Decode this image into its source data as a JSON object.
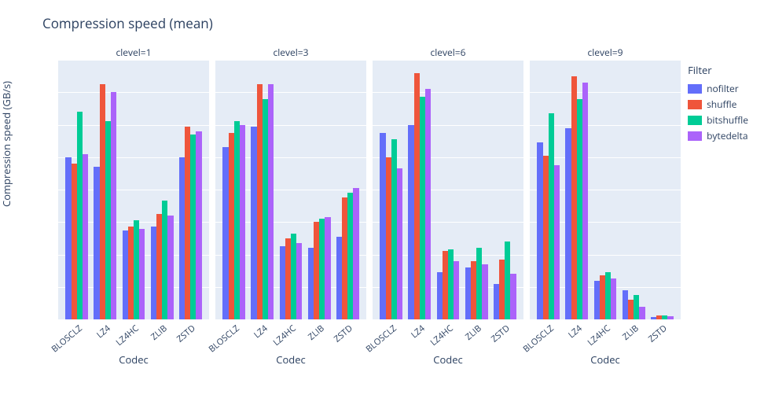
{
  "title": "Compression speed (mean)",
  "ylabel": "Compression speed (GB/s)",
  "xlabel": "Codec",
  "legend_title": "Filter",
  "filters": [
    "nofilter",
    "shuffle",
    "bitshuffle",
    "bytedelta"
  ],
  "colors": {
    "nofilter": "#636efa",
    "shuffle": "#ef553b",
    "bitshuffle": "#00cc96",
    "bytedelta": "#ab63fa"
  },
  "categories": [
    "BLOSCLZ",
    "LZ4",
    "LZ4HC",
    "ZLIB",
    "ZSTD"
  ],
  "yticks": [
    0,
    2,
    4,
    6,
    8,
    10,
    12,
    14,
    16
  ],
  "ylim": [
    0,
    16
  ],
  "facets": [
    {
      "title": "clevel=1"
    },
    {
      "title": "clevel=3"
    },
    {
      "title": "clevel=6"
    },
    {
      "title": "clevel=9"
    }
  ],
  "chart_data": [
    {
      "type": "bar",
      "title": "clevel=1",
      "xlabel": "Codec",
      "ylabel": "Compression speed (GB/s)",
      "ylim": [
        0,
        16
      ],
      "categories": [
        "BLOSCLZ",
        "LZ4",
        "LZ4HC",
        "ZLIB",
        "ZSTD"
      ],
      "series": [
        {
          "name": "nofilter",
          "values": [
            10.0,
            9.4,
            5.5,
            5.7,
            10.0
          ]
        },
        {
          "name": "shuffle",
          "values": [
            9.6,
            14.5,
            5.7,
            6.5,
            11.9
          ]
        },
        {
          "name": "bitshuffle",
          "values": [
            12.8,
            12.2,
            6.1,
            7.3,
            11.4
          ]
        },
        {
          "name": "bytedelta",
          "values": [
            10.2,
            14.0,
            5.6,
            6.4,
            11.6
          ]
        }
      ]
    },
    {
      "type": "bar",
      "title": "clevel=3",
      "xlabel": "Codec",
      "ylabel": "Compression speed (GB/s)",
      "ylim": [
        0,
        16
      ],
      "categories": [
        "BLOSCLZ",
        "LZ4",
        "LZ4HC",
        "ZLIB",
        "ZSTD"
      ],
      "series": [
        {
          "name": "nofilter",
          "values": [
            10.6,
            11.9,
            4.5,
            4.4,
            5.1
          ]
        },
        {
          "name": "shuffle",
          "values": [
            11.5,
            14.5,
            5.0,
            6.0,
            7.5
          ]
        },
        {
          "name": "bitshuffle",
          "values": [
            12.2,
            13.6,
            5.3,
            6.2,
            7.8
          ]
        },
        {
          "name": "bytedelta",
          "values": [
            12.0,
            14.5,
            4.7,
            6.3,
            8.1
          ]
        }
      ]
    },
    {
      "type": "bar",
      "title": "clevel=6",
      "xlabel": "Codec",
      "ylabel": "Compression speed (GB/s)",
      "ylim": [
        0,
        16
      ],
      "categories": [
        "BLOSCLZ",
        "LZ4",
        "LZ4HC",
        "ZLIB",
        "ZSTD"
      ],
      "series": [
        {
          "name": "nofilter",
          "values": [
            11.5,
            12.0,
            2.9,
            3.2,
            2.2
          ]
        },
        {
          "name": "shuffle",
          "values": [
            10.0,
            15.2,
            4.2,
            3.6,
            3.7
          ]
        },
        {
          "name": "bitshuffle",
          "values": [
            11.1,
            13.7,
            4.3,
            4.4,
            4.8
          ]
        },
        {
          "name": "bytedelta",
          "values": [
            9.3,
            14.2,
            3.6,
            3.4,
            2.8
          ]
        }
      ]
    },
    {
      "type": "bar",
      "title": "clevel=9",
      "xlabel": "Codec",
      "ylabel": "Compression speed (GB/s)",
      "ylim": [
        0,
        16
      ],
      "categories": [
        "BLOSCLZ",
        "LZ4",
        "LZ4HC",
        "ZLIB",
        "ZSTD"
      ],
      "series": [
        {
          "name": "nofilter",
          "values": [
            10.9,
            11.8,
            2.4,
            1.8,
            0.15
          ]
        },
        {
          "name": "shuffle",
          "values": [
            10.1,
            15.0,
            2.7,
            1.2,
            0.25
          ]
        },
        {
          "name": "bitshuffle",
          "values": [
            12.7,
            13.6,
            2.9,
            1.5,
            0.25
          ]
        },
        {
          "name": "bytedelta",
          "values": [
            9.5,
            14.6,
            2.5,
            0.8,
            0.2
          ]
        }
      ]
    }
  ]
}
